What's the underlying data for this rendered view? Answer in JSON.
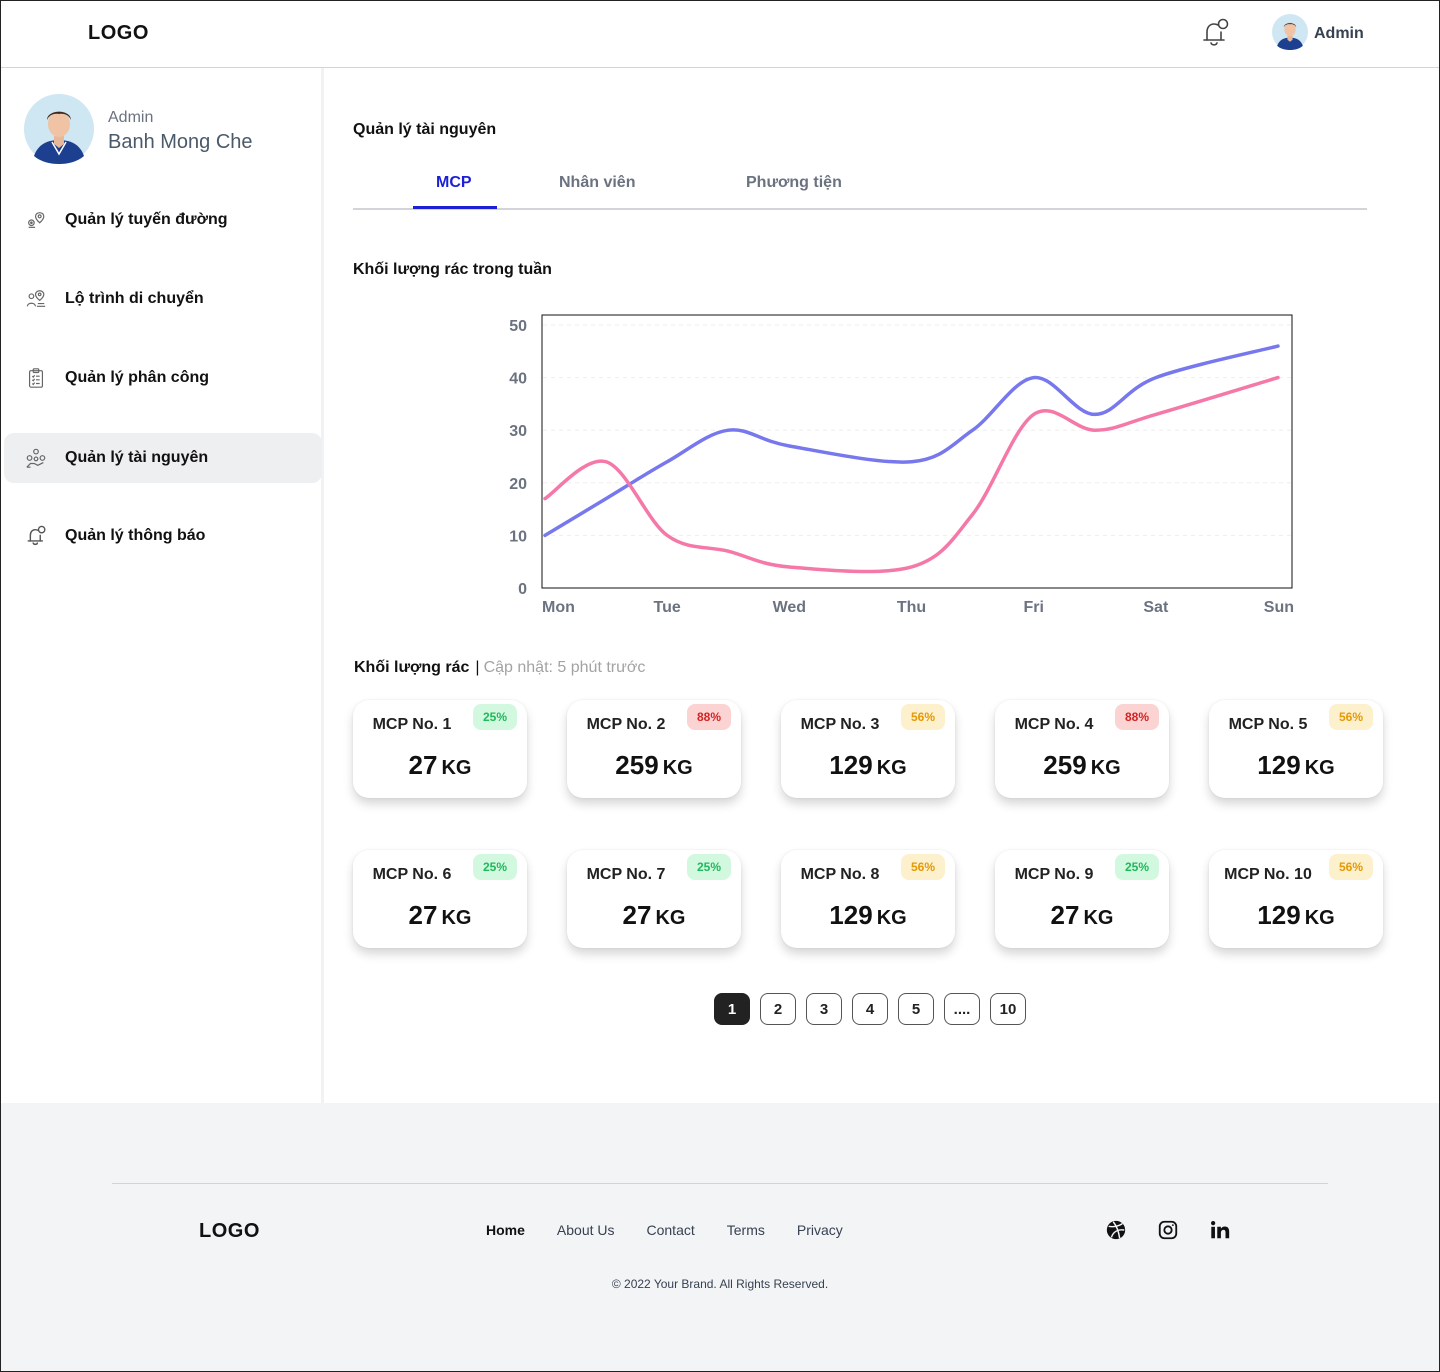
{
  "header": {
    "logo": "LOGO",
    "user_name": "Admin"
  },
  "sidebar": {
    "profile": {
      "role": "Admin",
      "name": "Banh Mong Che"
    },
    "items": [
      {
        "label": "Quản lý tuyến đường",
        "icon": "map-pin-icon",
        "active": false
      },
      {
        "label": "Lộ trình di chuyển",
        "icon": "route-icon",
        "active": false
      },
      {
        "label": "Quản lý phân công",
        "icon": "clipboard-icon",
        "active": false
      },
      {
        "label": "Quản lý tài nguyên",
        "icon": "resource-icon",
        "active": true
      },
      {
        "label": "Quản lý thông báo",
        "icon": "bell-icon",
        "active": false
      }
    ]
  },
  "main": {
    "title": "Quản lý tài nguyên",
    "tabs": [
      {
        "label": "MCP",
        "active": true
      },
      {
        "label": "Nhân viên",
        "active": false
      },
      {
        "label": "Phương tiện",
        "active": false
      }
    ],
    "chart_title": "Khối lượng rác trong tuần",
    "weight_title": "Khối lượng rác",
    "updated_text": "Cập nhật: 5 phút trước"
  },
  "chart_data": {
    "type": "line",
    "title": "",
    "categories": [
      "Mon",
      "Tue",
      "Wed",
      "Thu",
      "Fri",
      "Sat",
      "Sun"
    ],
    "x": [
      0,
      0.5,
      1,
      1.5,
      2,
      2.5,
      3,
      3.5,
      4,
      4.5,
      5,
      5.5,
      6
    ],
    "ylim": [
      0,
      50
    ],
    "yticks": [
      0,
      10,
      20,
      30,
      40,
      50
    ],
    "grid": true,
    "legend": "none",
    "series": [
      {
        "color": "#7777ee",
        "values": [
          10,
          17,
          24,
          30,
          27,
          24,
          30,
          40,
          33,
          40,
          46
        ]
      },
      {
        "color": "#f478a8",
        "values": [
          17,
          24,
          10,
          7,
          4,
          4,
          14,
          33,
          30,
          33,
          40
        ]
      }
    ]
  },
  "mcp_cards": [
    {
      "name": "MCP No. 1",
      "percent": "25%",
      "level": "g",
      "value": "27",
      "unit": "KG"
    },
    {
      "name": "MCP No. 2",
      "percent": "88%",
      "level": "r",
      "value": "259",
      "unit": "KG"
    },
    {
      "name": "MCP No. 3",
      "percent": "56%",
      "level": "y",
      "value": "129",
      "unit": "KG"
    },
    {
      "name": "MCP No. 4",
      "percent": "88%",
      "level": "r",
      "value": "259",
      "unit": "KG"
    },
    {
      "name": "MCP No. 5",
      "percent": "56%",
      "level": "y",
      "value": "129",
      "unit": "KG"
    },
    {
      "name": "MCP No. 6",
      "percent": "25%",
      "level": "g",
      "value": "27",
      "unit": "KG"
    },
    {
      "name": "MCP No. 7",
      "percent": "25%",
      "level": "g",
      "value": "27",
      "unit": "KG"
    },
    {
      "name": "MCP No. 8",
      "percent": "56%",
      "level": "y",
      "value": "129",
      "unit": "KG"
    },
    {
      "name": "MCP No. 9",
      "percent": "25%",
      "level": "g",
      "value": "27",
      "unit": "KG"
    },
    {
      "name": "MCP No. 10",
      "percent": "56%",
      "level": "y",
      "value": "129",
      "unit": "KG"
    }
  ],
  "pagination": {
    "pages": [
      "1",
      "2",
      "3",
      "4",
      "5",
      "....",
      "10"
    ],
    "current": "1"
  },
  "footer": {
    "logo": "LOGO",
    "links": [
      "Home",
      "About Us",
      "Contact",
      "Terms",
      "Privacy"
    ],
    "socials": [
      "dribbble-icon",
      "instagram-icon",
      "linkedin-icon"
    ],
    "copyright": "© 2022 Your Brand. All Rights Reserved."
  },
  "colors": {
    "accent": "#1d1fd6",
    "series_1": "#7777ee",
    "series_2": "#f478a8"
  }
}
